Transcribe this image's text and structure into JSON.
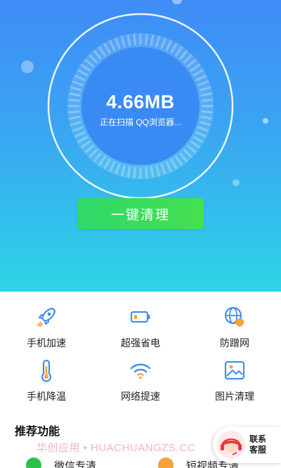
{
  "scan": {
    "size": "4.66MB",
    "status": "正在扫描 QQ浏览器..."
  },
  "actions": {
    "clean_label": "一键清理"
  },
  "features": [
    {
      "label": "手机加速",
      "icon": "rocket-icon"
    },
    {
      "label": "超强省电",
      "icon": "battery-icon"
    },
    {
      "label": "防蹭网",
      "icon": "globe-shield-icon"
    },
    {
      "label": "手机降温",
      "icon": "thermometer-icon"
    },
    {
      "label": "网络提速",
      "icon": "wifi-icon"
    },
    {
      "label": "图片清理",
      "icon": "image-icon"
    }
  ],
  "recommend": {
    "title": "推荐功能",
    "items": [
      {
        "label": "微信专清",
        "icon": "wechat-icon"
      },
      {
        "label": "短视频专清",
        "icon": "video-icon"
      }
    ]
  },
  "watermark": "华创应用 • HUACHUANGZS.CC",
  "service": {
    "label": "联系客服",
    "icon": "customer-service-icon"
  },
  "colors": {
    "hero_top": "#3f8cf6",
    "hero_bottom": "#2fd4e6",
    "button_green": "#2fd86a",
    "icon_blue": "#3e8ef0",
    "icon_orange": "#f5a23a"
  }
}
